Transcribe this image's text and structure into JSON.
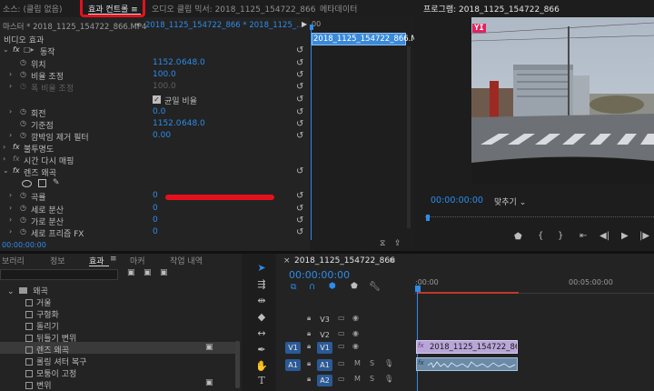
{
  "topTabs": {
    "source": "소스: (클립 없음)",
    "effectControls": "효과 컨트롤",
    "menuGlyph": "≡",
    "audioMixer": "오디오 클립 믹서: 2018_1125_154722_866",
    "metadata": "메타데이터",
    "program": "프로그램: 2018_1125_154722_866"
  },
  "effectControls": {
    "masterLabel": "마스터 * 2018_1125_154722_866.MP4",
    "sequenceLabel": "2018_1125_154722_866 * 2018_1125_...",
    "headerTime": "00",
    "sectionVideo": "비디오 효과",
    "motion": "동작",
    "position": "위치",
    "positionX": "1152.0",
    "positionY": "648.0",
    "scale": "비율 조정",
    "scaleVal": "100.0",
    "scaleWidth": "폭 비율 조정",
    "scaleWidthVal": "100.0",
    "uniformScale": "균일 비율",
    "rotation": "회전",
    "rotationVal": "0.0",
    "anchor": "기준점",
    "anchorX": "1152.0",
    "anchorY": "648.0",
    "flicker": "깜박임 제거 필터",
    "flickerVal": "0.00",
    "opacity": "불투명도",
    "timeRemap": "시간 다시 매핑",
    "lensDistortion": "렌즈 왜곡",
    "curvature": "곡률",
    "curvatureVal": "0",
    "vDecenter": "세로 분산",
    "vDecenterVal": "0",
    "hDecenter": "가로 분산",
    "hDecenterVal": "0",
    "fill": "세로 프리즘 FX",
    "fillVal": "0",
    "clipName": "2018_1125_154722_866.MP4",
    "footerTime": "00:00:00:00",
    "colors": {
      "accent": "#2d8ceb",
      "highlight": "#e4111d"
    }
  },
  "program": {
    "badge": "YI",
    "timecode": "00:00:00:00",
    "fit": "맞추기",
    "fitArrow": "⌄"
  },
  "effectsPanel": {
    "tabs": [
      "보러리",
      "정보",
      "효과",
      "마커",
      "작업 내역"
    ],
    "folder": "왜곡",
    "items": [
      "거울",
      "구형화",
      "돌리기",
      "뒤틀기 변위",
      "렌즈 왜곡",
      "롤링 셔터 복구",
      "모퉁이 고정",
      "변위"
    ]
  },
  "timeline": {
    "seqName": "2018_1125_154722_866",
    "timecode": "00:00:00:00",
    "ruler1": ":00:00",
    "ruler2": "00:05:00:00",
    "tracks": [
      {
        "name": "V3",
        "src": ""
      },
      {
        "name": "V2",
        "src": ""
      },
      {
        "name": "V1",
        "src": "V1"
      },
      {
        "name": "A1",
        "src": "A1"
      },
      {
        "name": "A2",
        "src": ""
      }
    ],
    "trackM": "M",
    "trackS": "S",
    "clipVideo": "2018_1125_154722_866.MP4",
    "clipFx": "fx"
  }
}
